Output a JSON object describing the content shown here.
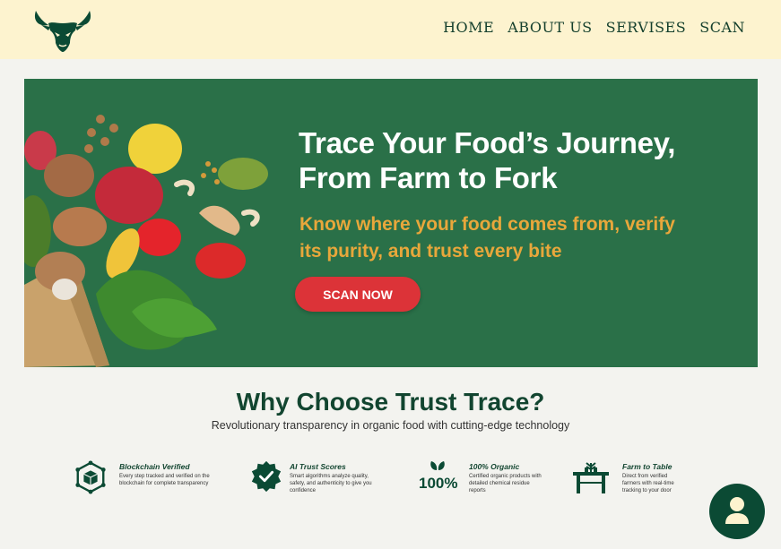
{
  "nav": {
    "logo_icon": "bull-head-logo-icon",
    "items": [
      {
        "label": "HOME"
      },
      {
        "label": "ABOUT US"
      },
      {
        "label": "SERVISES"
      },
      {
        "label": "SCAN"
      }
    ]
  },
  "hero": {
    "title_line1": "Trace Your Food’s Journey,",
    "title_line2": "From Farm to Fork",
    "subtitle_line1": "Know where your food comes from, verify",
    "subtitle_line2": "its purity, and trust every bite",
    "cta_label": "SCAN NOW"
  },
  "why": {
    "title": "Why Choose Trust Trace?",
    "subtitle": "Revolutionary transparency in organic food with cutting-edge technology"
  },
  "features": [
    {
      "icon": "blockchain-cube-icon",
      "title": "Blockchain Verified",
      "desc": "Every step tracked and verified on the blockchain for complete transparency"
    },
    {
      "icon": "verified-badge-icon",
      "title": "AI Trust Scores",
      "desc": "Smart algorithms analyze quality, safety, and authenticity to give you confidence"
    },
    {
      "icon": "organic-100-icon",
      "title": "100% Organic",
      "desc": "Certified organic products with detailed chemical residue reports"
    },
    {
      "icon": "farm-to-table-icon",
      "title": "Farm to Table",
      "desc": "Direct from verified farmers with real-time tracking to your door"
    }
  ],
  "profile": {
    "icon": "user-avatar-icon"
  },
  "colors": {
    "header_bg": "#fdf3cf",
    "brand_green": "#124530",
    "hero_green": "#2a7048",
    "accent_orange": "#e8a73b",
    "cta_red": "#dc3338"
  }
}
